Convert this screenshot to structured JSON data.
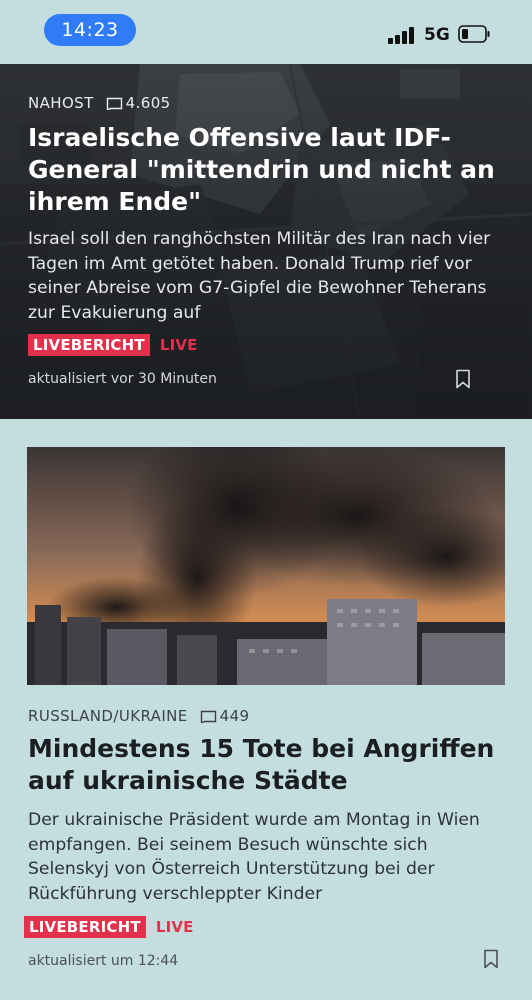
{
  "status_bar": {
    "time": "14:23",
    "network": "5G",
    "battery_level": 0.25
  },
  "articles": [
    {
      "category": "NAHOST",
      "comment_count": "4.605",
      "title": "Israelische Offensive laut IDF-General \"mittendrin und nicht an ihrem Ende\"",
      "teaser": "Israel soll den ranghöchsten Militär des Iran nach vier Tagen im Amt getötet haben. Donald Trump rief vor seiner Abreise vom G7-Gipfel die Bewohner Teherans zur Evakuierung auf",
      "badge_label": "LIVEBERICHT",
      "live_label": "LIVE",
      "updated": "aktualisiert vor 30 Minuten"
    },
    {
      "category": "RUSSLAND/UKRAINE",
      "comment_count": "449",
      "title": "Mindestens 15 Tote bei Angriffen auf ukrainische Städte",
      "teaser": "Der ukrainische Präsident wurde am Montag in Wien empfangen. Bei seinem Besuch wünschte sich Selenskyj von Österreich Unterstützung bei der Rückführung verschleppter Kinder",
      "badge_label": "LIVEBERICHT",
      "live_label": "LIVE",
      "updated": "aktualisiert um 12:44"
    }
  ],
  "colors": {
    "background": "#c4dedf",
    "accent_red": "#e3304b",
    "time_pill": "#2f7cf6"
  },
  "icons": {
    "comment": "comment-icon",
    "bookmark": "bookmark-icon",
    "signal": "signal-icon",
    "battery": "battery-icon"
  }
}
